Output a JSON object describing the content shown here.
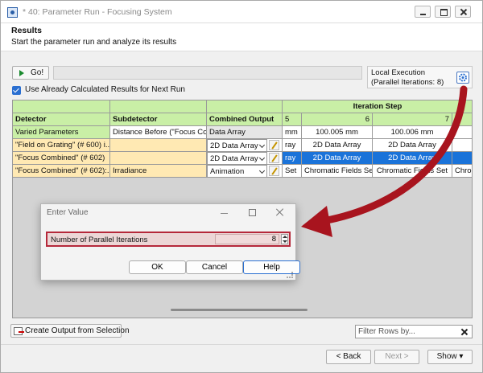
{
  "window": {
    "title": "* 40: Parameter Run - Focusing System"
  },
  "header": {
    "title": "Results",
    "subtitle": "Start the parameter run and analyze its results"
  },
  "toolbar": {
    "go_label": "Go!",
    "execution_line1": "Local Execution",
    "execution_line2": "(Parallel Iterations: 8)",
    "use_cached_label": "Use Already Calculated Results for Next Run",
    "use_cached_checked": true
  },
  "grid": {
    "group_header": "Iteration Step",
    "headers": {
      "detector": "Detector",
      "subdetector": "Subdetector",
      "combined_output": "Combined Output",
      "col5": "5",
      "col6": "6",
      "col7": "7"
    },
    "rows": [
      {
        "detector": "Varied Parameters",
        "subdetector": "Distance Before (\"Focus Co...",
        "combined": "Data Array",
        "c5": "mm",
        "c6": "100.005 mm",
        "c7": "100.006 mm",
        "c8": ""
      },
      {
        "detector": "\"Field on Grating\" (# 600) i...",
        "subdetector": "",
        "combined": "2D Data Array",
        "c5": "ray",
        "c6": "2D Data Array",
        "c7": "2D Data Array",
        "c8": ""
      },
      {
        "detector": "\"Focus Combined\" (# 602)",
        "subdetector": "",
        "combined": "2D Data Array",
        "c5": "ray",
        "c6": "2D Data Array",
        "c7": "2D Data Array",
        "c8": ""
      },
      {
        "detector": "\"Focus Combined\" (# 602):...",
        "subdetector": "Irradiance",
        "combined": "Animation",
        "c5": "Set",
        "c6": "Chromatic Fields Set",
        "c7": "Chromatic Fields Set",
        "c8": "Chron"
      }
    ]
  },
  "dialog": {
    "title": "Enter Value",
    "field_label": "Number of Parallel Iterations",
    "field_value": "8",
    "ok_label": "OK",
    "cancel_label": "Cancel",
    "help_label": "Help"
  },
  "bottom": {
    "create_output_label": "Create Output from Selection",
    "filter_placeholder": "Filter Rows by...",
    "back_label": "< Back",
    "next_label": "Next >",
    "show_label": "Show ▾"
  },
  "colors": {
    "header_green": "#c9efa6",
    "detector_yellow": "#ffe9b3",
    "selection_blue": "#1a73d9",
    "highlight_red": "#b5283a"
  }
}
